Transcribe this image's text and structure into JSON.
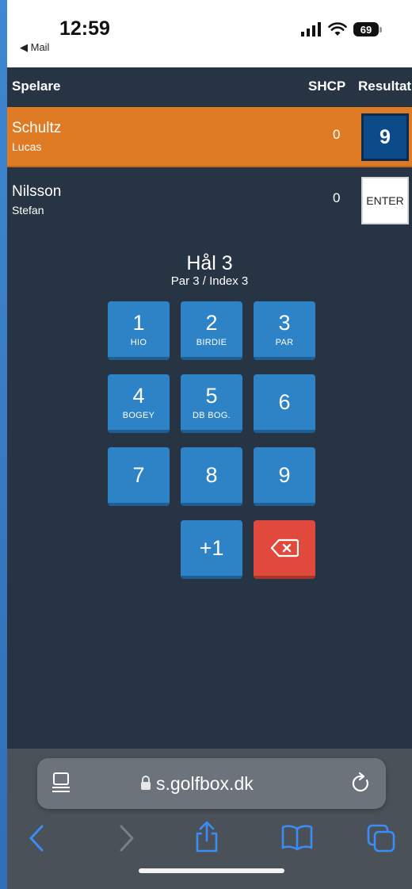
{
  "status_bar": {
    "time": "12:59",
    "back_app": "◀ Mail",
    "battery": "69"
  },
  "table": {
    "col_player": "Spelare",
    "col_shcp": "SHCP",
    "col_result": "Resultat",
    "players": [
      {
        "last": "Schultz",
        "first": "Lucas",
        "shcp": "0",
        "result": "9"
      },
      {
        "last": "Nilsson",
        "first": "Stefan",
        "shcp": "0",
        "result": "ENTER"
      }
    ]
  },
  "hole": {
    "title": "Hål 3",
    "subtitle": "Par 3 / Index 3"
  },
  "keypad": {
    "keys": [
      {
        "num": "1",
        "sub": "HIO"
      },
      {
        "num": "2",
        "sub": "BIRDIE"
      },
      {
        "num": "3",
        "sub": "PAR"
      },
      {
        "num": "4",
        "sub": "BOGEY"
      },
      {
        "num": "5",
        "sub": "DB BOG."
      },
      {
        "num": "6",
        "sub": ""
      },
      {
        "num": "7",
        "sub": ""
      },
      {
        "num": "8",
        "sub": ""
      },
      {
        "num": "9",
        "sub": ""
      },
      {
        "num": "+1",
        "sub": ""
      }
    ]
  },
  "browser": {
    "url": "s.golfbox.dk"
  },
  "colors": {
    "active_row": "#e07b25",
    "keypad_key": "#2e83c6",
    "delete_key": "#e04a3d",
    "background": "#263443"
  }
}
